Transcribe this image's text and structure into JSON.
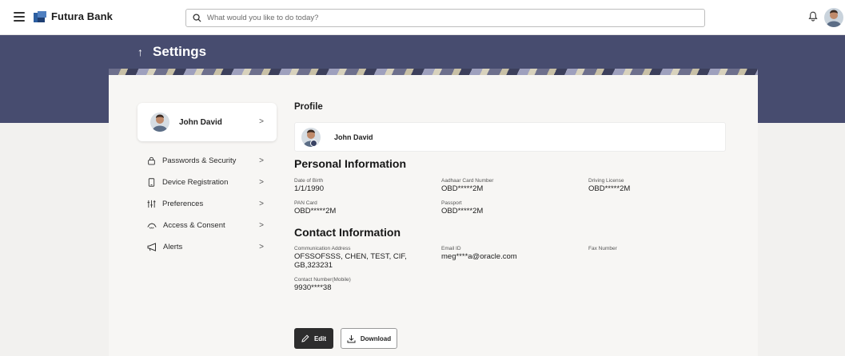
{
  "app": {
    "brand": "Futura Bank"
  },
  "search": {
    "placeholder": "What would you like to do today?"
  },
  "page": {
    "title": "Settings"
  },
  "sidebar": {
    "profile_name": "John David",
    "items": [
      {
        "label": "Passwords & Security",
        "icon": "lock-icon"
      },
      {
        "label": "Device Registration",
        "icon": "device-icon"
      },
      {
        "label": "Preferences",
        "icon": "sliders-icon"
      },
      {
        "label": "Access & Consent",
        "icon": "handshake-icon"
      },
      {
        "label": "Alerts",
        "icon": "megaphone-icon"
      }
    ]
  },
  "profile": {
    "heading": "Profile",
    "name": "John David"
  },
  "personal": {
    "heading": "Personal Information",
    "dob_label": "Date of Birth",
    "dob": "1/1/1990",
    "aadhaar_label": "Aadhaar Card Number",
    "aadhaar": "OBD*****2M",
    "dl_label": "Driving License",
    "dl": "OBD*****2M",
    "pan_label": "PAN Card",
    "pan": "OBD*****2M",
    "passport_label": "Passport",
    "passport": "OBD*****2M"
  },
  "contact": {
    "heading": "Contact Information",
    "address_label": "Communication Address",
    "address_line1": "OFSSOFSSS, CHEN, TEST,  CIF,",
    "address_line2": "GB,323231",
    "email_label": "Email ID",
    "email": "meg****a@oracle.com",
    "fax_label": "Fax Number",
    "mobile_label": "Contact Number(Mobile)",
    "mobile": "9930****38"
  },
  "actions": {
    "edit": "Edit",
    "download": "Download"
  },
  "colors": {
    "banner": "#474c6f",
    "edit_button": "#2d2d2d",
    "brand_mark": "#2c5ea0"
  }
}
